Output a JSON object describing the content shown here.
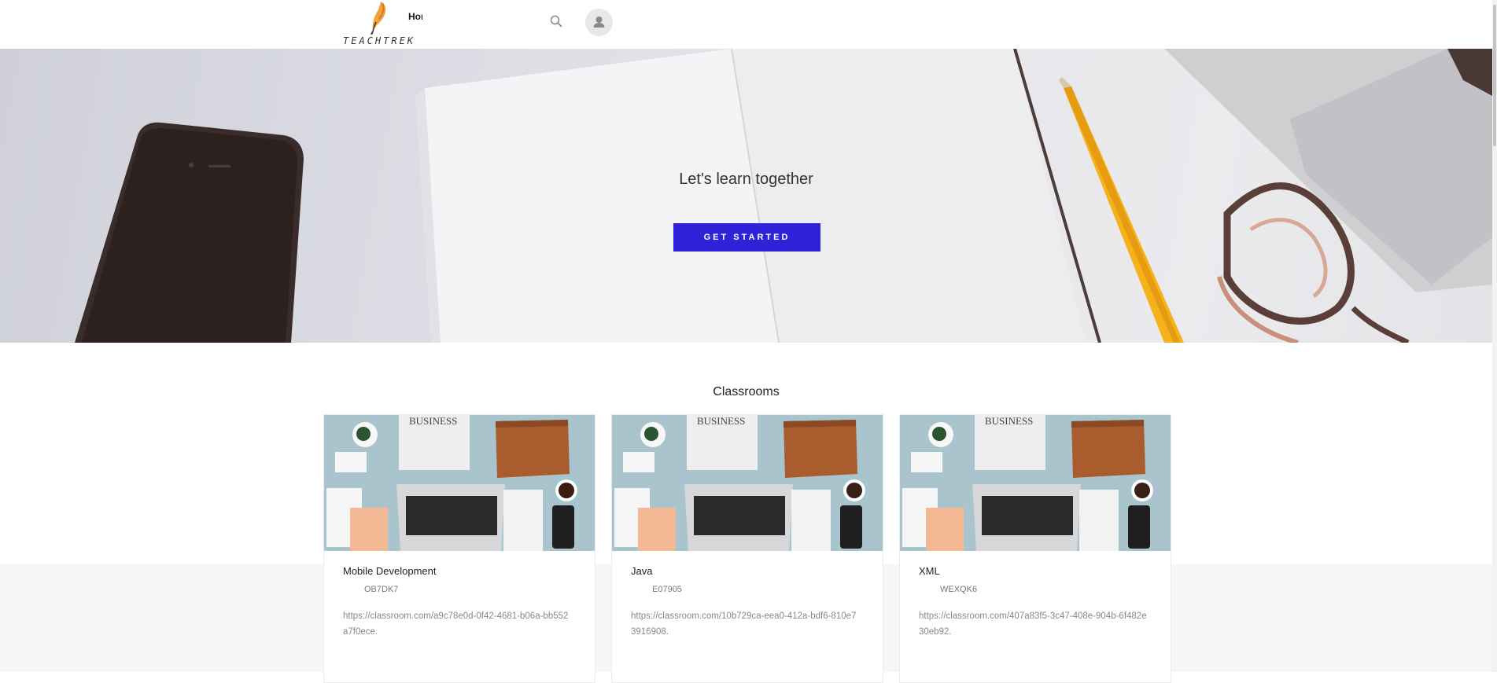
{
  "header": {
    "logo_text": "TEACHTREK",
    "nav_label": "Home"
  },
  "hero": {
    "title": "Let's learn together",
    "cta_label": "GET STARTED"
  },
  "classrooms": {
    "title": "Classrooms",
    "cards": [
      {
        "name": "Mobile Development",
        "code": "OB7DK7",
        "link": "https://classroom.com/a9c78e0d-0f42-4681-b06a-bb552a7f0ece."
      },
      {
        "name": "Java",
        "code": "E07905",
        "link": "https://classroom.com/10b729ca-eea0-412a-bdf6-810e73916908."
      },
      {
        "name": "XML",
        "code": "WEXQK6",
        "link": "https://classroom.com/407a83f5-3c47-408e-904b-6f482e30eb92."
      }
    ]
  },
  "colors": {
    "accent": "#2f22d8",
    "page_bg": "#ffffff",
    "band_bg": "#f6f6f6"
  },
  "icons": [
    "logo-feather-icon",
    "search-icon",
    "user-icon"
  ]
}
